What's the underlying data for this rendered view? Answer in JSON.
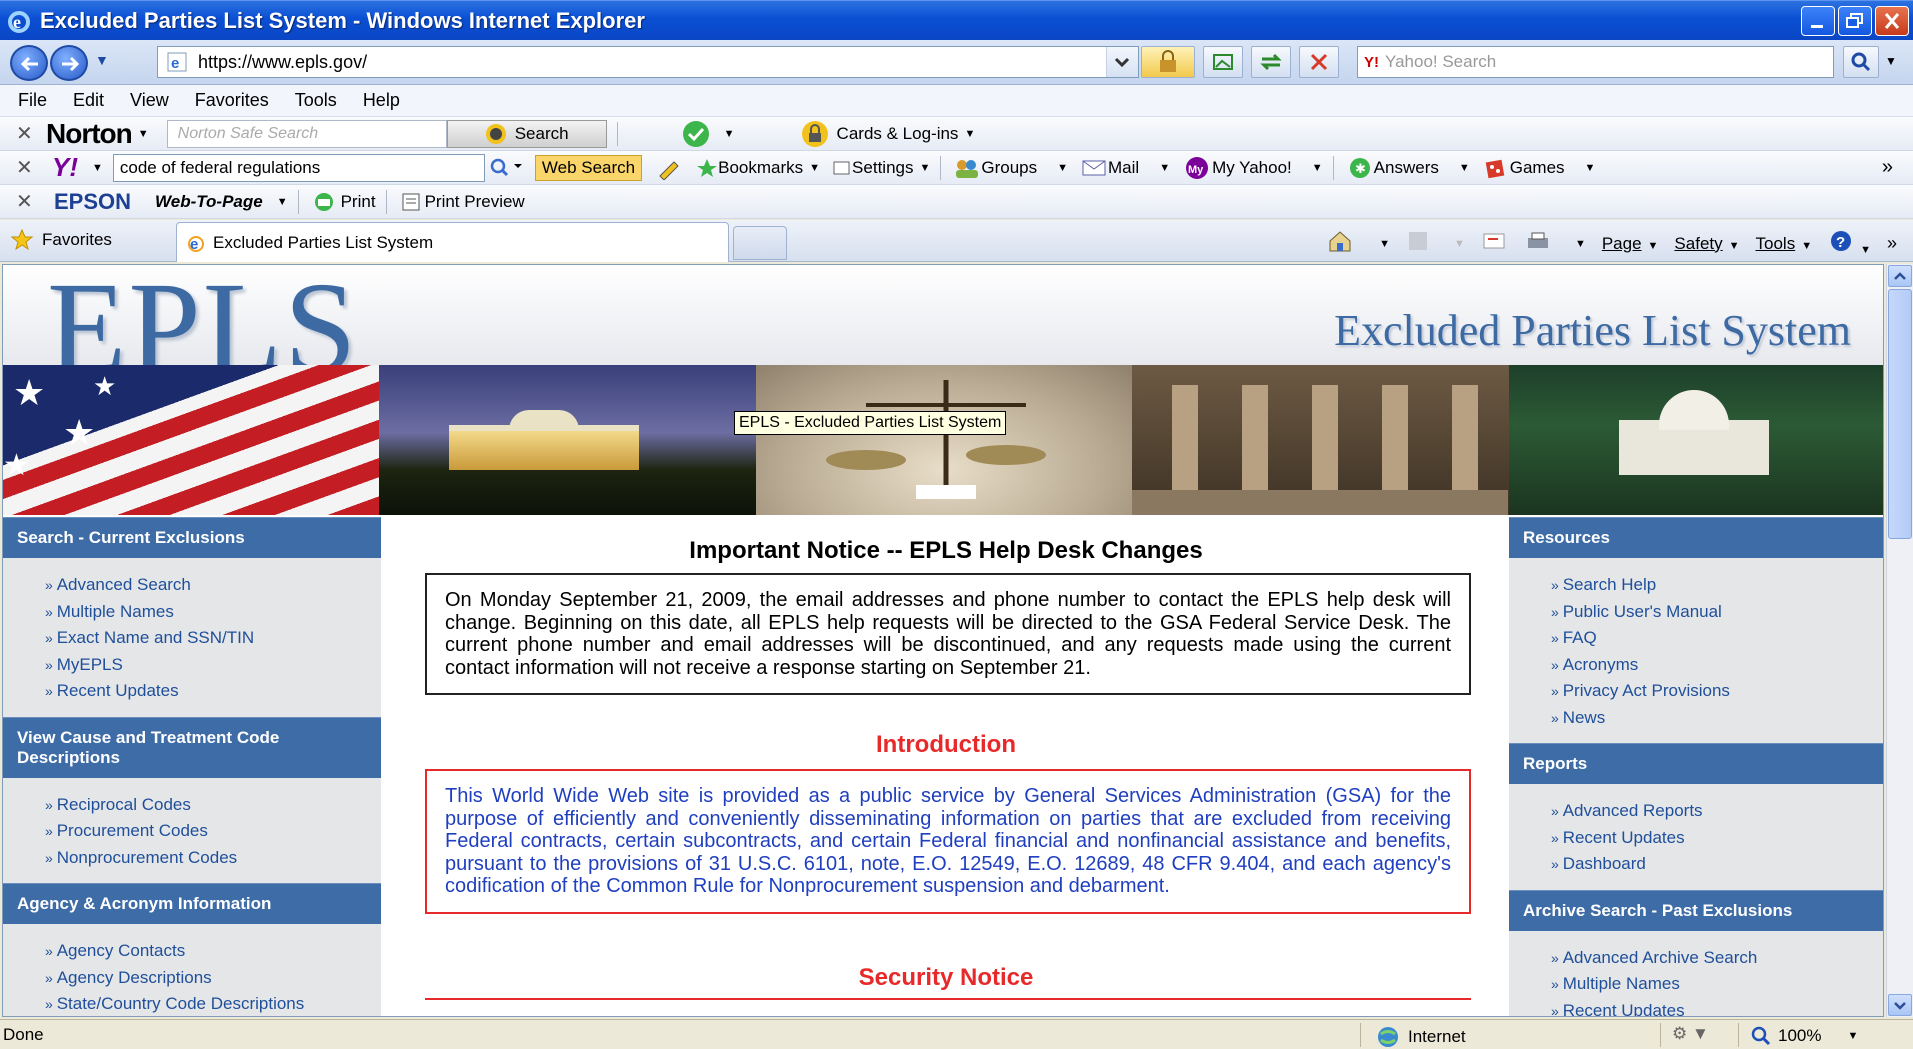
{
  "window": {
    "title": "Excluded Parties List System - Windows Internet Explorer"
  },
  "address_bar": {
    "url": "https://www.epls.gov/",
    "search_placeholder": "Yahoo! Search"
  },
  "menu": [
    "File",
    "Edit",
    "View",
    "Favorites",
    "Tools",
    "Help"
  ],
  "norton_toolbar": {
    "brand": "Norton",
    "search_placeholder": "Norton Safe Search",
    "search_button": "Search",
    "cards_label": "Cards & Log-ins"
  },
  "yahoo_toolbar": {
    "query": "code of federal regulations",
    "web_search": "Web Search",
    "bookmarks": "Bookmarks",
    "settings": "Settings",
    "groups": "Groups",
    "mail": "Mail",
    "my_yahoo": "My Yahoo!",
    "answers": "Answers",
    "games": "Games"
  },
  "epson_toolbar": {
    "brand": "EPSON",
    "web_to_page": "Web-To-Page",
    "print": "Print",
    "print_preview": "Print Preview"
  },
  "tabs": {
    "favorites": "Favorites",
    "active_tab": "Excluded Parties List System"
  },
  "command_bar": {
    "page": "Page",
    "safety": "Safety",
    "tools": "Tools"
  },
  "page": {
    "logo": "EPLS",
    "subtitle": "Excluded Parties List System",
    "tooltip": "EPLS - Excluded Parties List System",
    "left": [
      {
        "header": "Search - Current Exclusions",
        "links": [
          "Advanced Search",
          "Multiple Names",
          "Exact Name and SSN/TIN",
          "MyEPLS",
          "Recent Updates"
        ]
      },
      {
        "header": "View Cause and Treatment Code Descriptions",
        "links": [
          "Reciprocal Codes",
          "Procurement Codes",
          "Nonprocurement Codes"
        ]
      },
      {
        "header": "Agency & Acronym Information",
        "links": [
          "Agency Contacts",
          "Agency Descriptions",
          "State/Country Code Descriptions"
        ]
      }
    ],
    "right": [
      {
        "header": "Resources",
        "links": [
          "Search Help",
          "Public User's Manual",
          "FAQ",
          "Acronyms",
          "Privacy Act Provisions",
          "News"
        ]
      },
      {
        "header": "Reports",
        "links": [
          "Advanced Reports",
          "Recent Updates",
          "Dashboard"
        ]
      },
      {
        "header": "Archive Search - Past Exclusions",
        "links": [
          "Advanced Archive Search",
          "Multiple Names",
          "Recent Updates"
        ]
      }
    ],
    "notice_title": "Important Notice -- EPLS Help Desk Changes",
    "notice_text": "On Monday September 21, 2009, the email addresses and phone number to contact the EPLS help desk will change. Beginning on this date, all EPLS help requests will be directed to the GSA Federal Service Desk. The current phone number and email addresses will be discontinued, and any requests made using the current contact information will not receive a response starting on September 21.",
    "intro_title": "Introduction",
    "intro_text": "This World Wide Web site is provided as a public service by General Services Administration (GSA) for the purpose of efficiently and conveniently disseminating information on parties that are excluded from receiving Federal contracts, certain subcontracts, and certain Federal financial and nonfinancial assistance and benefits, pursuant to the provisions of 31 U.S.C. 6101, note, E.O. 12549, E.O. 12689, 48 CFR 9.404, and each agency's codification of the Common Rule for Nonprocurement suspension and debarment.",
    "security_title": "Security Notice"
  },
  "status": {
    "text": "Done",
    "zone": "Internet",
    "zoom": "100%"
  }
}
